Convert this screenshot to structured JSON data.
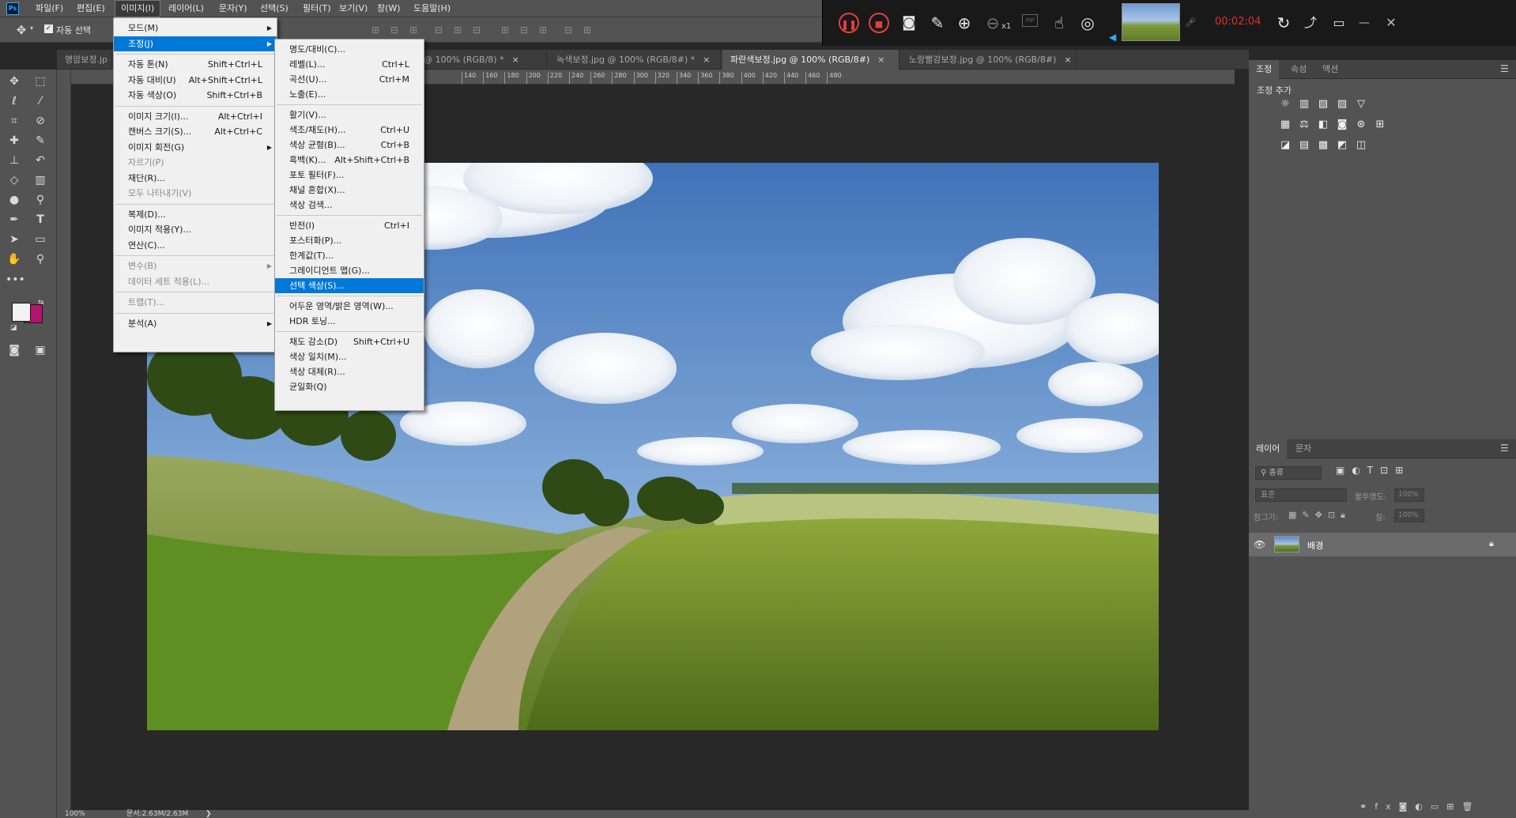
{
  "app": {
    "logo_text": "Ps"
  },
  "menubar": [
    "파일(F)",
    "편집(E)",
    "이미지(I)",
    "레이어(L)",
    "문자(Y)",
    "선택(S)",
    "필터(T)",
    "보기(V)",
    "창(W)",
    "도움말(H)"
  ],
  "options": {
    "auto_select_label": "자동 선택"
  },
  "recorder": {
    "time": "00:02:04",
    "speed": "x1",
    "pip": "PIP"
  },
  "doc_tabs": [
    {
      "label": "명암보정.jp",
      "close": ""
    },
    {
      "label": "정.jpg @ 100% (RGB/8) *",
      "close": "×"
    },
    {
      "label": "녹색보정.jpg @ 100% (RGB/8#) *",
      "close": "×"
    },
    {
      "label": "파란색보정.jpg @ 100% (RGB/8#)",
      "close": "×"
    },
    {
      "label": "노랑빨강보정.jpg @ 100% (RGB/8#)",
      "close": "×"
    }
  ],
  "ruler_ticks": [
    "140",
    "160",
    "180",
    "200",
    "220",
    "240",
    "260",
    "280",
    "300",
    "320",
    "340",
    "360",
    "380",
    "400",
    "420",
    "440",
    "460",
    "480"
  ],
  "image_menu": [
    {
      "label": "모드(M)",
      "arrow": "▶"
    },
    {
      "label": "조정(J)",
      "arrow": "▶",
      "highlight": true
    },
    {
      "sep": true
    },
    {
      "label": "자동 톤(N)",
      "shortcut": "Shift+Ctrl+L"
    },
    {
      "label": "자동 대비(U)",
      "shortcut": "Alt+Shift+Ctrl+L"
    },
    {
      "label": "자동 색상(O)",
      "shortcut": "Shift+Ctrl+B"
    },
    {
      "sep": true
    },
    {
      "label": "이미지 크기(I)...",
      "shortcut": "Alt+Ctrl+I"
    },
    {
      "label": "캔버스 크기(S)...",
      "shortcut": "Alt+Ctrl+C"
    },
    {
      "label": "이미지 회전(G)",
      "arrow": "▶"
    },
    {
      "label": "자르기(P)",
      "disabled": true
    },
    {
      "label": "재단(R)..."
    },
    {
      "label": "모두 나타내기(V)",
      "disabled": true
    },
    {
      "sep": true
    },
    {
      "label": "복제(D)..."
    },
    {
      "label": "이미지 적용(Y)..."
    },
    {
      "label": "연산(C)..."
    },
    {
      "sep": true
    },
    {
      "label": "변수(B)",
      "arrow": "▶",
      "disabled": true
    },
    {
      "label": "데이터 세트 적용(L)...",
      "disabled": true
    },
    {
      "sep": true
    },
    {
      "label": "트랩(T)...",
      "disabled": true
    },
    {
      "sep": true
    },
    {
      "label": "분석(A)",
      "arrow": "▶"
    }
  ],
  "adjust_menu": [
    {
      "label": "명도/대비(C)..."
    },
    {
      "label": "레벨(L)...",
      "shortcut": "Ctrl+L"
    },
    {
      "label": "곡선(U)...",
      "shortcut": "Ctrl+M"
    },
    {
      "label": "노출(E)..."
    },
    {
      "sep": true
    },
    {
      "label": "활기(V)..."
    },
    {
      "label": "색조/채도(H)...",
      "shortcut": "Ctrl+U"
    },
    {
      "label": "색상 균형(B)...",
      "shortcut": "Ctrl+B"
    },
    {
      "label": "흑백(K)...",
      "shortcut": "Alt+Shift+Ctrl+B"
    },
    {
      "label": "포토 필터(F)..."
    },
    {
      "label": "채널 혼합(X)..."
    },
    {
      "label": "색상 검색..."
    },
    {
      "sep": true
    },
    {
      "label": "반전(I)",
      "shortcut": "Ctrl+I"
    },
    {
      "label": "포스터화(P)..."
    },
    {
      "label": "한계값(T)..."
    },
    {
      "label": "그레이디언트 맵(G)..."
    },
    {
      "label": "선택 색상(S)...",
      "highlight": true
    },
    {
      "sep": true
    },
    {
      "label": "어두운 영역/밝은 영역(W)..."
    },
    {
      "label": "HDR 토닝..."
    },
    {
      "sep": true
    },
    {
      "label": "채도 감소(D)",
      "shortcut": "Shift+Ctrl+U"
    },
    {
      "label": "색상 일치(M)..."
    },
    {
      "label": "색상 대체(R)..."
    },
    {
      "label": "균일화(Q)"
    }
  ],
  "adjust_panel": {
    "tabs": [
      "조정",
      "속성",
      "액션"
    ],
    "title": "조정 추가"
  },
  "layers_panel": {
    "tabs": [
      "레이어",
      "문자"
    ],
    "kind_label": "종류",
    "blend_mode": "표준",
    "opacity_label": "불투명도:",
    "opacity_value": "100%",
    "lock_label": "잠그기:",
    "fill_label": "칠:",
    "fill_value": "100%",
    "layer_name": "배경"
  },
  "status": {
    "zoom": "100%",
    "doc": "문서:2.63M/2.63M",
    "arrow": "❯"
  },
  "colors": {
    "foreground": "#f2f2f2",
    "background": "#b4146e",
    "accent": "#0078d7"
  }
}
